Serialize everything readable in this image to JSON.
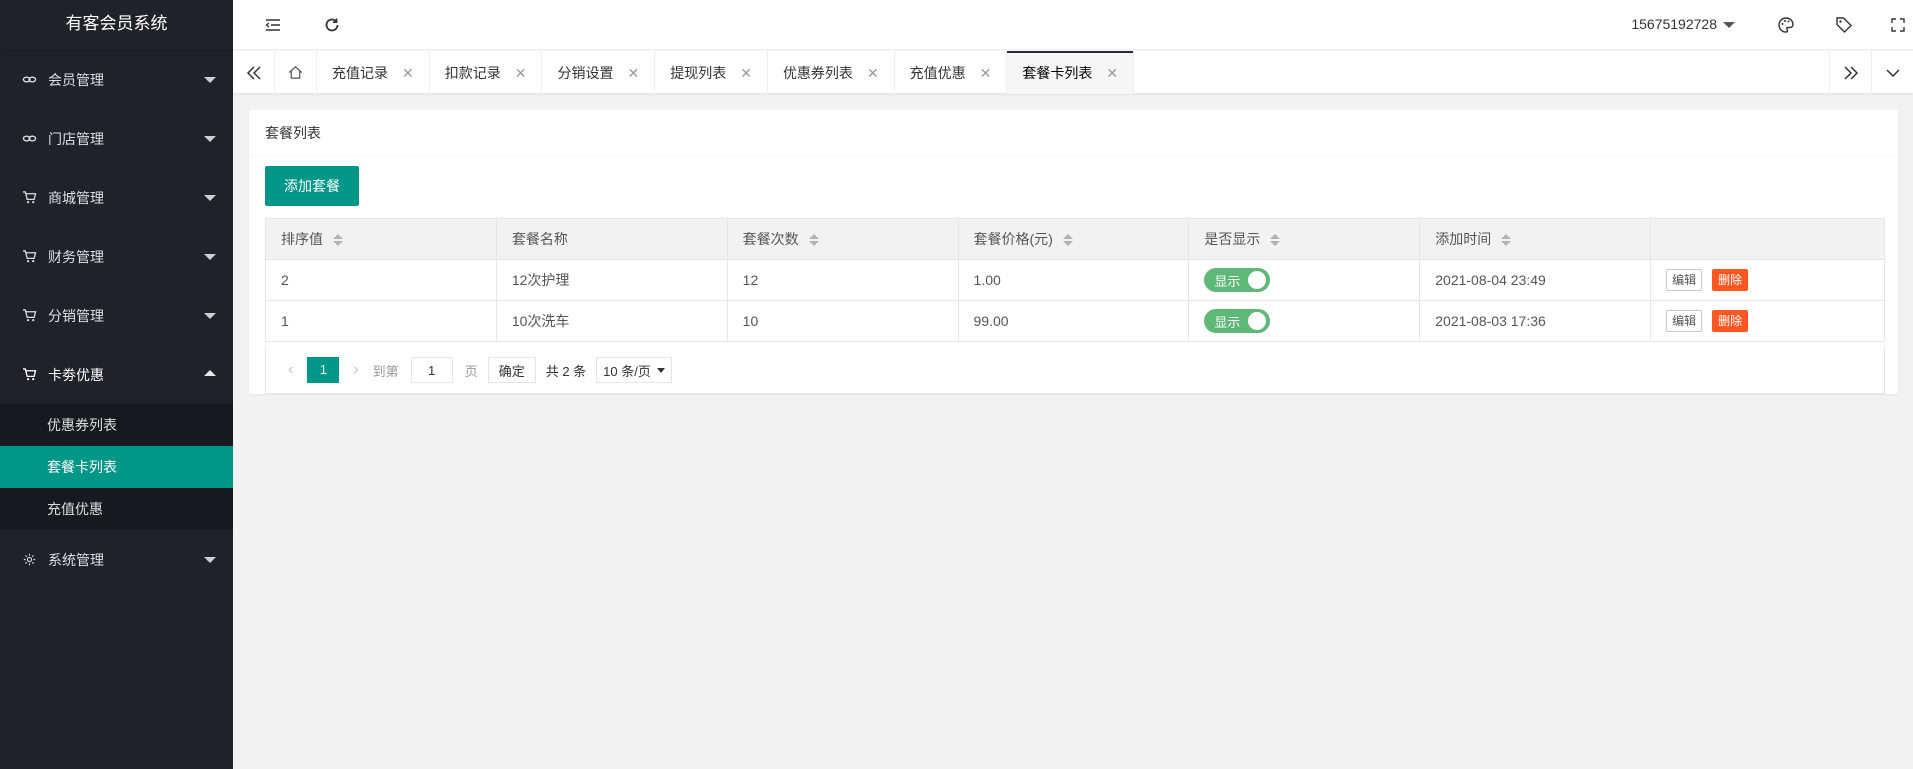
{
  "app": {
    "title": "有客会员系统"
  },
  "sidebar": {
    "items": [
      {
        "label": "会员管理",
        "icon": "link-icon"
      },
      {
        "label": "门店管理",
        "icon": "link-icon"
      },
      {
        "label": "商城管理",
        "icon": "cart-icon"
      },
      {
        "label": "财务管理",
        "icon": "cart-icon"
      },
      {
        "label": "分销管理",
        "icon": "cart-icon"
      },
      {
        "label": "卡劵优惠",
        "icon": "cart-icon",
        "expanded": true,
        "children": [
          {
            "label": "优惠券列表"
          },
          {
            "label": "套餐卡列表",
            "active": true
          },
          {
            "label": "充值优惠"
          }
        ]
      },
      {
        "label": "系统管理",
        "icon": "gear-icon"
      }
    ]
  },
  "header": {
    "user": "15675192728"
  },
  "tabs": [
    {
      "label": "充值记录"
    },
    {
      "label": "扣款记录"
    },
    {
      "label": "分销设置"
    },
    {
      "label": "提现列表"
    },
    {
      "label": "优惠券列表"
    },
    {
      "label": "充值优惠"
    },
    {
      "label": "套餐卡列表",
      "active": true
    }
  ],
  "card": {
    "title": "套餐列表",
    "add_button": "添加套餐"
  },
  "table": {
    "columns": [
      "排序值",
      "套餐名称",
      "套餐次数",
      "套餐价格(元)",
      "是否显示",
      "添加时间",
      ""
    ],
    "rows": [
      {
        "sort": "2",
        "name": "12次护理",
        "count": "12",
        "price": "1.00",
        "show": "显示",
        "time": "2021-08-04 23:49",
        "edit": "编辑",
        "del": "删除"
      },
      {
        "sort": "1",
        "name": "10次洗车",
        "count": "10",
        "price": "99.00",
        "show": "显示",
        "time": "2021-08-03 17:36",
        "edit": "编辑",
        "del": "删除"
      }
    ]
  },
  "pager": {
    "current": "1",
    "goto_prefix": "到第",
    "goto_value": "1",
    "goto_suffix": "页",
    "confirm": "确定",
    "total": "共 2 条",
    "page_size": "10 条/页"
  },
  "colors": {
    "accent": "#009688",
    "sidebar_bg": "#20222a",
    "switch_on": "#5fb878",
    "danger": "#ff5722"
  }
}
